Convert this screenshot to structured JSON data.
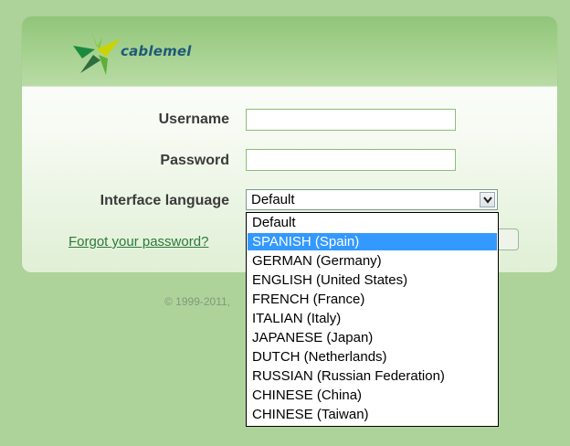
{
  "header": {
    "brand": "cablemel"
  },
  "form": {
    "username_label": "Username",
    "username_value": "",
    "password_label": "Password",
    "password_value": "",
    "language_label": "Interface language",
    "language_selected": "Default",
    "forgot_link": "Forgot your password?"
  },
  "footer": {
    "copyright": "© 1999-2011,"
  },
  "dropdown": {
    "highlighted": "SPANISH (Spain)",
    "options": [
      "Default",
      "SPANISH (Spain)",
      "GERMAN (Germany)",
      "ENGLISH (United States)",
      "FRENCH (France)",
      "ITALIAN (Italy)",
      "JAPANESE (Japan)",
      "DUTCH (Netherlands)",
      "RUSSIAN (Russian Federation)",
      "CHINESE (China)",
      "CHINESE (Taiwan)"
    ]
  },
  "colors": {
    "background": "#aed39a",
    "header": "#a5d18f",
    "link": "#2a7a3a",
    "highlight": "#3399ff",
    "brand_text": "#1e5a7a"
  }
}
